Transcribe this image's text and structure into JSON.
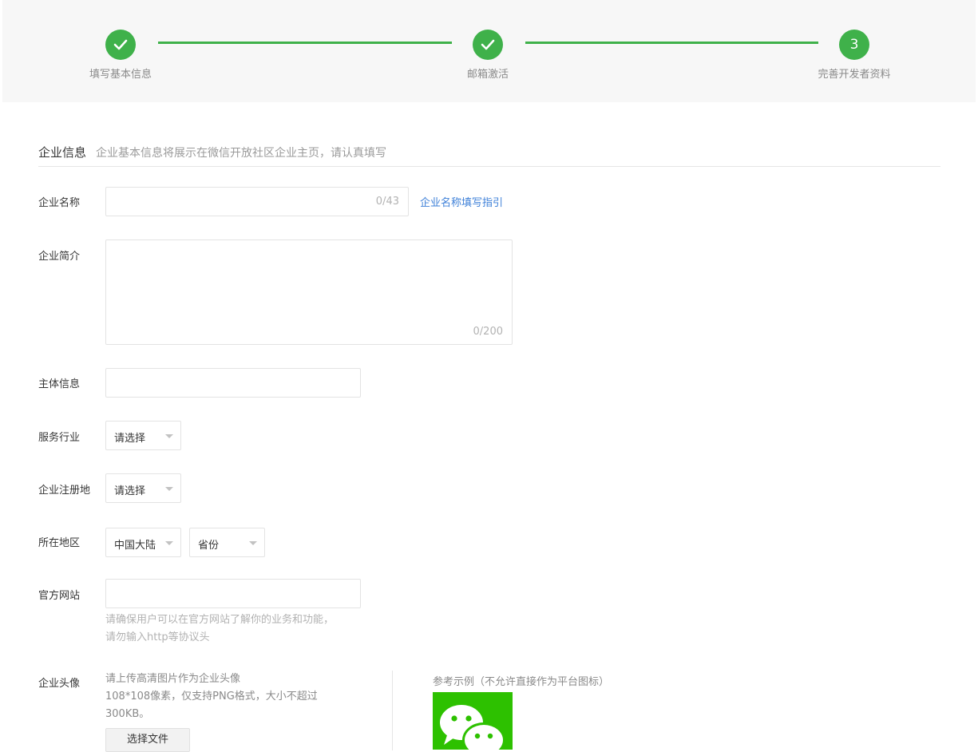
{
  "stepper": {
    "steps": [
      {
        "label": "填写基本信息",
        "state": "done",
        "icon": "check-icon"
      },
      {
        "label": "邮箱激活",
        "state": "done",
        "icon": "check-icon"
      },
      {
        "label": "完善开发者资料",
        "state": "current",
        "number": "3"
      }
    ],
    "accent_color": "#3fb14a"
  },
  "section": {
    "title": "企业信息",
    "description": "企业基本信息将展示在微信开放社区企业主页，请认真填写"
  },
  "form": {
    "company_name": {
      "label": "企业名称",
      "value": "",
      "counter": "0/43",
      "guide_link": "企业名称填写指引"
    },
    "company_intro": {
      "label": "企业简介",
      "value": "",
      "counter": "0/200"
    },
    "entity_info": {
      "label": "主体信息",
      "value": ""
    },
    "industry": {
      "label": "服务行业",
      "selected": "请选择"
    },
    "reg_place": {
      "label": "企业注册地",
      "selected": "请选择"
    },
    "region": {
      "label": "所在地区",
      "country": "中国大陆",
      "province": "省份"
    },
    "website": {
      "label": "官方网站",
      "value": "",
      "hint_line1": "请确保用户可以在官方网站了解你的业务和功能，",
      "hint_line2": "请勿输入http等协议头"
    },
    "avatar": {
      "label": "企业头像",
      "desc_line1": "请上传高清图片作为企业头像",
      "desc_line2": "108*108像素，仅支持PNG格式，大小不超过",
      "desc_line3": "300KB。",
      "button": "选择文件",
      "sample_label": "参考示例（不允许直接作为平台图标）",
      "sample_icon": "wechat-logo-icon",
      "sample_color": "#2dc100"
    }
  }
}
